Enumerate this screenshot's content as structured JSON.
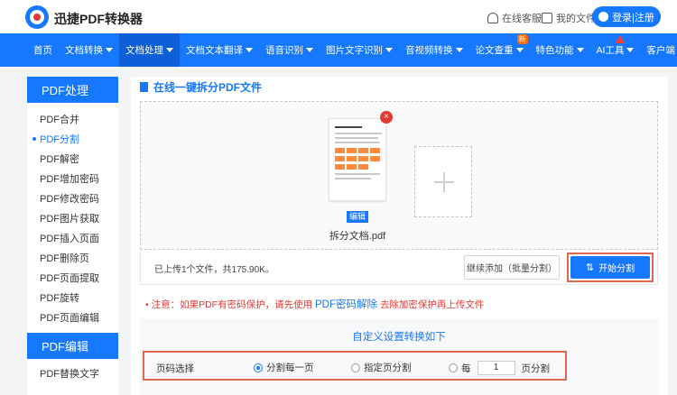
{
  "header": {
    "brand": "迅捷PDF转换器",
    "service_label": "在线客服",
    "files_label": "我的文件",
    "login_label": "登录|注册"
  },
  "nav": {
    "items": [
      {
        "label": "首页",
        "caret": false
      },
      {
        "label": "文档转换",
        "caret": true
      },
      {
        "label": "文档处理",
        "caret": true,
        "active": true
      },
      {
        "label": "文档文本翻译",
        "caret": true
      },
      {
        "label": "语音识别",
        "caret": true
      },
      {
        "label": "图片文字识别",
        "caret": true
      },
      {
        "label": "音视频转换",
        "caret": true
      },
      {
        "label": "论文查重",
        "caret": true,
        "badge": "新"
      },
      {
        "label": "特色功能",
        "caret": true
      },
      {
        "label": "AI工具",
        "caret": true,
        "hot": true
      },
      {
        "label": "客户端",
        "caret": true
      }
    ]
  },
  "sidebar": {
    "section1": "PDF处理",
    "items1": [
      "PDF合并",
      "PDF分割",
      "PDF解密",
      "PDF增加密码",
      "PDF修改密码",
      "PDF图片获取",
      "PDF插入页面",
      "PDF删除页",
      "PDF页面提取",
      "PDF旋转",
      "PDF页面编辑"
    ],
    "active_index": 1,
    "section2": "PDF编辑",
    "items2": [
      "PDF替换文字"
    ]
  },
  "main": {
    "title": "在线一键拆分PDF文件",
    "file": {
      "name": "拆分文档.pdf",
      "edit_tag": "编辑",
      "delete_icon": "×"
    },
    "status": "已上传1个文件，共175.90K。",
    "continue_label": "继续添加（批量分割）",
    "start_label": "开始分割",
    "notice_prefix": "• 注意：如果PDF有密码保护，请先使用",
    "notice_link": "PDF密码解除",
    "notice_suffix": "去除加密保护再上传文件",
    "settings_title": "自定义设置转换如下",
    "option_label": "页码选择",
    "options": {
      "split_each": "分割每一页",
      "split_specified": "指定页分割",
      "every_prefix": "每",
      "every_value": "1",
      "every_suffix": "页分割"
    }
  },
  "colors": {
    "accent": "#1677ff",
    "highlight_outline": "#e0674f",
    "warning": "#e53935"
  }
}
